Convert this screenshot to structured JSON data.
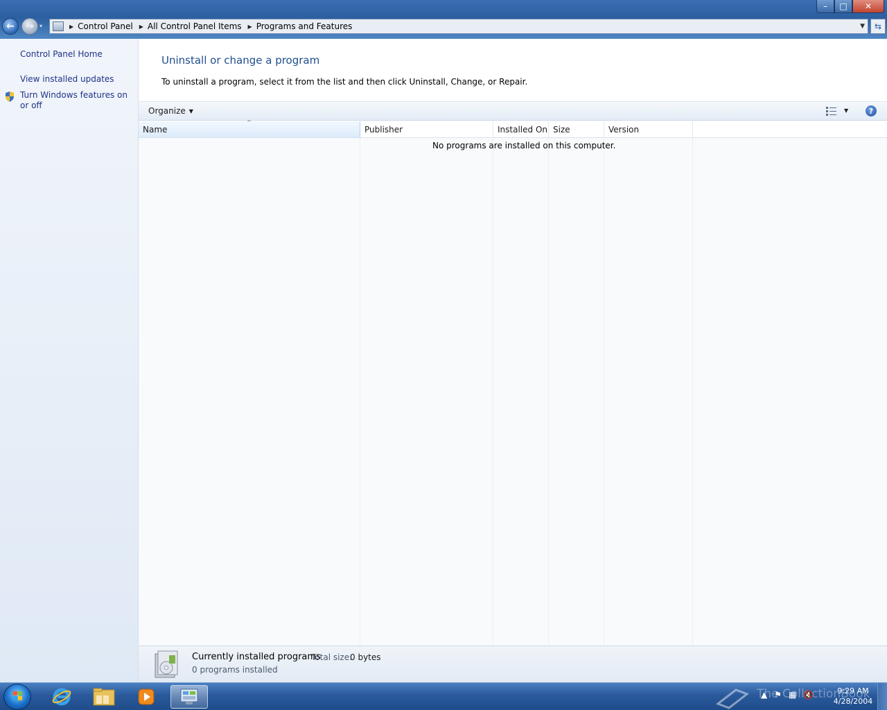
{
  "window": {
    "controls": {
      "minimize": "–",
      "maximize": "□",
      "close": "✕"
    }
  },
  "navigation": {
    "back_icon": "←",
    "forward_icon": "→",
    "recent_icon": "▾",
    "breadcrumb": [
      "Control Panel",
      "All Control Panel Items",
      "Programs and Features"
    ],
    "refresh_icon": "⇆"
  },
  "sidebar": {
    "links": [
      {
        "label": "Control Panel Home"
      },
      {
        "label": "View installed updates"
      },
      {
        "label": "Turn Windows features on or off",
        "icon": "shield-icon"
      }
    ]
  },
  "main": {
    "title": "Uninstall or change a program",
    "description": "To uninstall a program, select it from the list and then click Uninstall, Change, or Repair."
  },
  "toolbar": {
    "organize_label": "Organize",
    "organize_caret": "▼",
    "views_caret": "▼",
    "help_label": "?"
  },
  "list": {
    "sort_indicator": "^",
    "columns": [
      {
        "label": "Name",
        "sorted": true
      },
      {
        "label": "Publisher"
      },
      {
        "label": "Installed On"
      },
      {
        "label": "Size"
      },
      {
        "label": "Version"
      }
    ],
    "empty_message": "No programs are installed on this computer."
  },
  "details": {
    "title": "Currently installed programs",
    "total_size_label": "Total size:",
    "total_size_value": "0 bytes",
    "count": "0 programs installed"
  },
  "taskbar": {
    "pinned": [
      "internet-explorer-icon",
      "windows-explorer-icon",
      "media-player-icon",
      "control-panel-icon"
    ],
    "clock_time": "9:29 AM",
    "clock_date": "4/28/2004",
    "watermark": "The CollectionBook"
  }
}
